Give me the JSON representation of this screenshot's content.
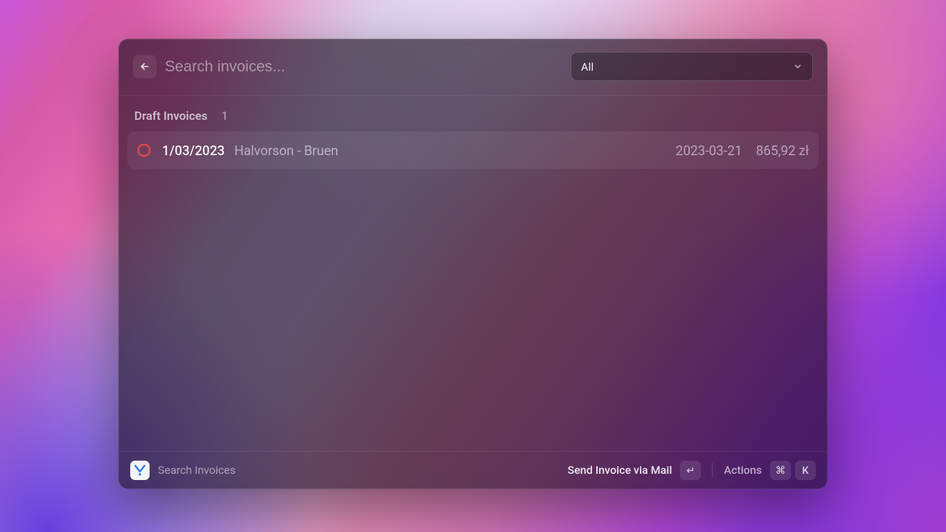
{
  "search": {
    "placeholder": "Search invoices...",
    "value": ""
  },
  "filter": {
    "selected": "All"
  },
  "section": {
    "title": "Draft Invoices",
    "count": "1"
  },
  "rows": [
    {
      "status_color": "#e24a4a",
      "number": "1/03/2023",
      "client": "Halvorson - Bruen",
      "date": "2023-03-21",
      "amount": "865,92 zł"
    }
  ],
  "footer": {
    "app_title": "Search Invoices",
    "primary_action": "Send Invoice via Mail",
    "enter_key": "↵",
    "actions_label": "Actions",
    "cmd_key": "⌘",
    "k_key": "K"
  }
}
